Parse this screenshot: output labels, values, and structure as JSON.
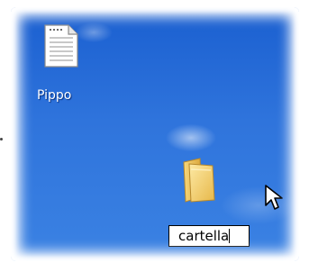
{
  "desktop": {
    "items": [
      {
        "label": "Pippo",
        "icon": "text-file-icon"
      },
      {
        "label": "cartella",
        "icon": "folder-icon",
        "renaming": true
      }
    ]
  },
  "cursor": {
    "icon": "arrow-cursor-icon"
  },
  "colors": {
    "desktop_blue": "#2f74dc",
    "folder_yellow": "#f2cf6b"
  }
}
